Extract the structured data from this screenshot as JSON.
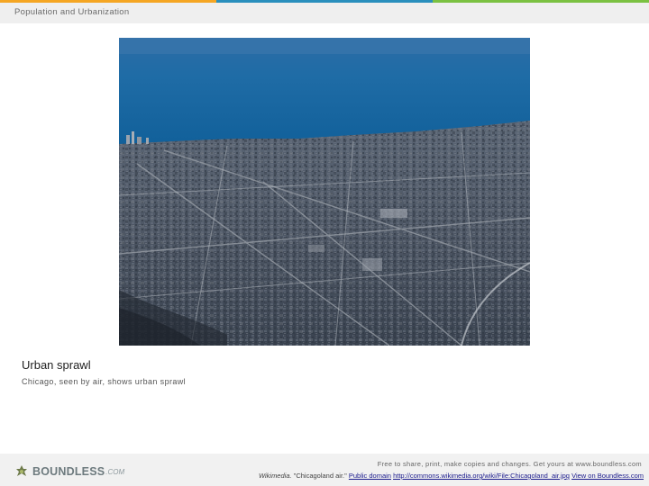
{
  "header": {
    "title": "Population and Urbanization",
    "stripe_colors": [
      "#f5a623",
      "#2a8fbd",
      "#7bc142"
    ]
  },
  "figure": {
    "image_alt": "Chicago aerial photo",
    "caption_title": "Urban sprawl",
    "caption_text": "Chicago, seen by air, shows urban sprawl"
  },
  "footer": {
    "logo_word": "BOUNDLESS",
    "logo_dotcom": ".COM",
    "line1": "Free to share, print, make copies and changes. Get yours at www.boundless.com",
    "source": "Wikimedia.",
    "attribution": " \"Chicagoland air.\" ",
    "license_link": "Public domain",
    "url_link": "http://commons.wikimedia.org/wiki/File:Chicagoland_air.jpg",
    "view_link": "View on Boundless.com"
  }
}
